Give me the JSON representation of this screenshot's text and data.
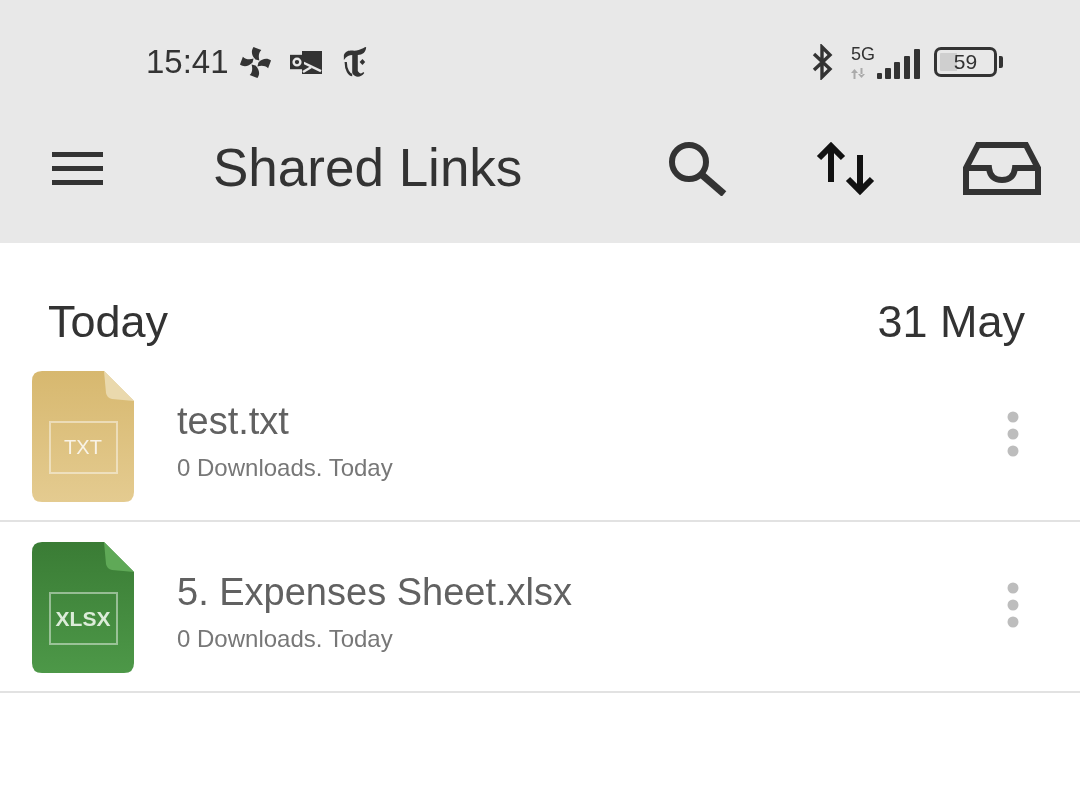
{
  "status_bar": {
    "time": "15:41",
    "network": "5G",
    "battery": "59"
  },
  "toolbar": {
    "title": "Shared Links"
  },
  "section": {
    "title": "Today",
    "date": "31 May",
    "items": [
      {
        "kind": "txt",
        "type_label": "TXT",
        "name": "test.txt",
        "details": "0 Downloads. Today"
      },
      {
        "kind": "xlsx",
        "type_label": "XLSX",
        "name": "5. Expenses Sheet.xlsx",
        "details": "0 Downloads. Today"
      }
    ]
  }
}
